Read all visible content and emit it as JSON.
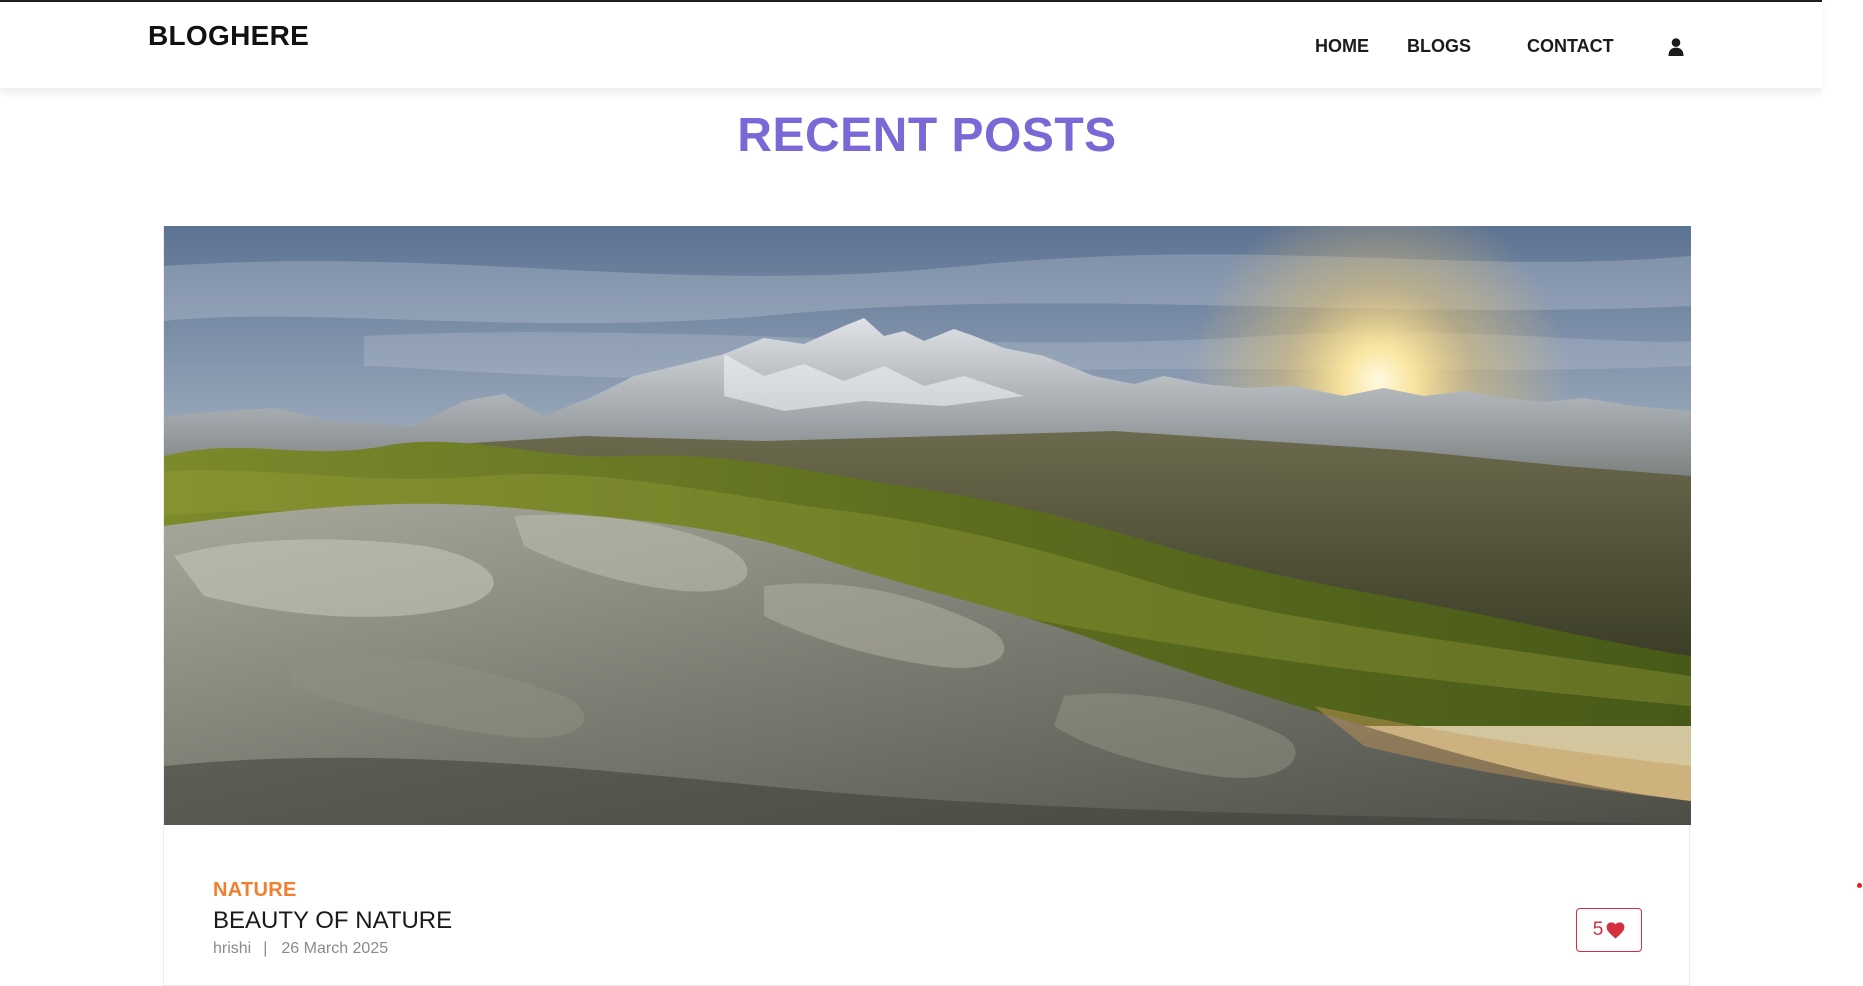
{
  "brand": "BLOGHERE",
  "nav": {
    "home": "HOME",
    "blogs": "BLOGS",
    "contact": "CONTACT",
    "user_icon": "user-icon"
  },
  "section_title": "RECENT POSTS",
  "post": {
    "image_icon": "mountain-sunrise-image",
    "category": "NATURE",
    "title": "BEAUTY OF NATURE",
    "author": "hrishi",
    "separator": "|",
    "date": "26 March 2025",
    "likes": "5",
    "like_icon": "heart-icon"
  },
  "colors": {
    "accent": "#7b68d6",
    "category": "#f07f2e",
    "like": "#d52f3e"
  }
}
